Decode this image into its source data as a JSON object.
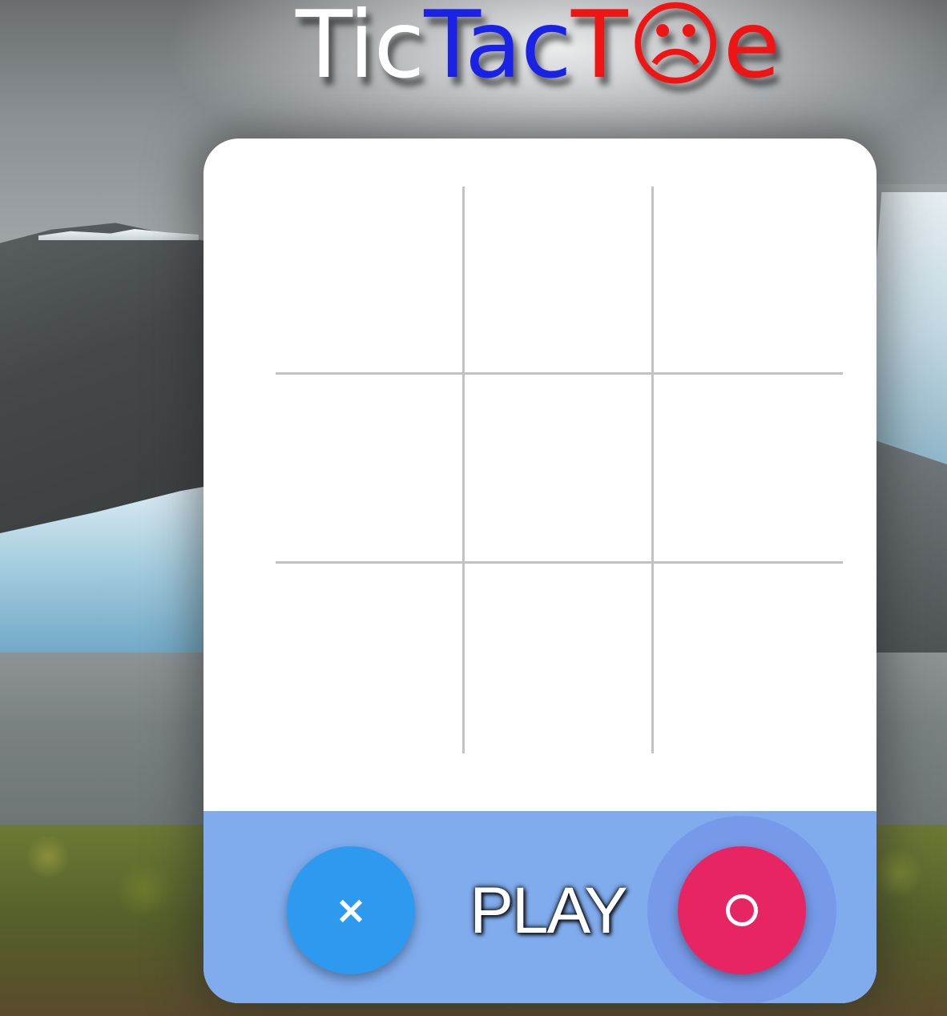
{
  "title": {
    "segments": [
      {
        "text": "Tic",
        "color": "#ffffff"
      },
      {
        "text": "Tac",
        "color": "#1a22e6"
      },
      {
        "text": "T",
        "color": "#f01515"
      },
      {
        "text": "☹",
        "color": "#f01515"
      },
      {
        "text": "e",
        "color": "#f01515"
      }
    ]
  },
  "board": {
    "cells": [
      "",
      "",
      "",
      "",
      "",
      "",
      "",
      "",
      ""
    ]
  },
  "footer": {
    "x_button_label": "×",
    "play_label": "PLAY",
    "o_button_label": "O"
  },
  "colors": {
    "x_button": "#2d9af0",
    "o_button": "#e82563",
    "footer_bar": "#80acee",
    "grid_line": "#c2c2c2"
  }
}
